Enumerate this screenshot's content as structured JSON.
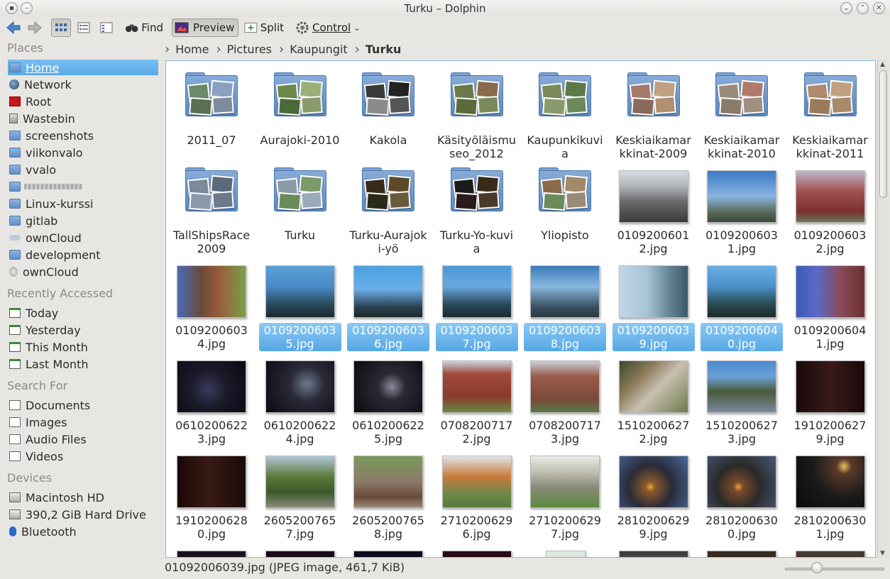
{
  "window": {
    "title": "Turku – Dolphin"
  },
  "toolbar": {
    "find": "Find",
    "preview": "Preview",
    "split": "Split",
    "control": "Control"
  },
  "places": {
    "sections": [
      {
        "title": "Places",
        "items": [
          {
            "label": "Home",
            "icon": "home-folder-icon",
            "selected": true
          },
          {
            "label": "Network",
            "icon": "network-globe-icon"
          },
          {
            "label": "Root",
            "icon": "root-folder-icon"
          },
          {
            "label": "Wastebin",
            "icon": "trash-icon"
          },
          {
            "label": "screenshots",
            "icon": "folder-icon"
          },
          {
            "label": "viikonvalo",
            "icon": "folder-icon"
          },
          {
            "label": "vvalo",
            "icon": "folder-icon"
          },
          {
            "label": "",
            "icon": "folder-icon",
            "blurred": true
          },
          {
            "label": "Linux-kurssi",
            "icon": "folder-icon"
          },
          {
            "label": "gitlab",
            "icon": "folder-icon"
          },
          {
            "label": "ownCloud",
            "icon": "cloud-icon"
          },
          {
            "label": "development",
            "icon": "globe-folder-icon"
          },
          {
            "label": "ownCloud",
            "icon": "network-drive-icon"
          }
        ]
      },
      {
        "title": "Recently Accessed",
        "items": [
          {
            "label": "Today",
            "icon": "calendar-today-icon"
          },
          {
            "label": "Yesterday",
            "icon": "calendar-yesterday-icon"
          },
          {
            "label": "This Month",
            "icon": "calendar-month-icon"
          },
          {
            "label": "Last Month",
            "icon": "calendar-last-month-icon"
          }
        ]
      },
      {
        "title": "Search For",
        "items": [
          {
            "label": "Documents",
            "icon": "document-icon"
          },
          {
            "label": "Images",
            "icon": "image-icon"
          },
          {
            "label": "Audio Files",
            "icon": "audio-icon"
          },
          {
            "label": "Videos",
            "icon": "video-icon"
          }
        ]
      },
      {
        "title": "Devices",
        "items": [
          {
            "label": "Macintosh HD",
            "icon": "harddrive-icon"
          },
          {
            "label": "390,2 GiB Hard Drive",
            "icon": "harddrive-icon"
          },
          {
            "label": "Bluetooth",
            "icon": "bluetooth-icon"
          }
        ]
      }
    ]
  },
  "breadcrumb": [
    "Home",
    "Pictures",
    "Kaupungit",
    "Turku"
  ],
  "files": [
    {
      "name": "2011_07",
      "type": "folder",
      "colors": [
        "#6a8a6a",
        "#8aa0c0",
        "#5a7050",
        "#7c8c9c"
      ]
    },
    {
      "name": "Aurajoki-2010",
      "type": "folder",
      "colors": [
        "#6a8a4a",
        "#9ab07a",
        "#4a6a3a",
        "#8a9a6a"
      ]
    },
    {
      "name": "Kakola",
      "type": "folder",
      "colors": [
        "#3a3a3a",
        "#222",
        "#8a8a8a",
        "#555"
      ]
    },
    {
      "name": "Käsityöläismuseo_2012",
      "type": "folder",
      "colors": [
        "#6a7a4a",
        "#8a6a4a",
        "#5a6a3a",
        "#7a8a5a"
      ]
    },
    {
      "name": "Kaupunkikuvia",
      "type": "folder",
      "colors": [
        "#7a8a5a",
        "#5a7a4a",
        "#8a9a6a",
        "#6a8a5a"
      ]
    },
    {
      "name": "Keskiaikamarkkinat-2009",
      "type": "folder",
      "colors": [
        "#a87a6a",
        "#c0a080",
        "#8a6a5a",
        "#b09070"
      ]
    },
    {
      "name": "Keskiaikamarkkinat-2010",
      "type": "folder",
      "colors": [
        "#9a8a7a",
        "#b07a6a",
        "#8a7a6a",
        "#a09080"
      ]
    },
    {
      "name": "Keskiaikamarkkinat-2011",
      "type": "folder",
      "colors": [
        "#b08a6a",
        "#c0a080",
        "#9a7a5a",
        "#a88a6a"
      ]
    },
    {
      "name": "TallShipsRace2009",
      "type": "folder",
      "colors": [
        "#7a8a9a",
        "#5a6a7a",
        "#8a9aaa",
        "#6a7a8a"
      ]
    },
    {
      "name": "Turku",
      "type": "folder",
      "colors": [
        "#8a9aaa",
        "#7a9a6a",
        "#6a8a5a",
        "#9aaabb"
      ]
    },
    {
      "name": "Turku-Aurajoki-yö",
      "type": "folder",
      "colors": [
        "#3a2a1a",
        "#5a4a2a",
        "#2a2a1a",
        "#6a5a3a"
      ]
    },
    {
      "name": "Turku-Yo-kuvia",
      "type": "folder",
      "colors": [
        "#1a1a1a",
        "#3a2a1a",
        "#2a1a1a",
        "#4a3a2a"
      ]
    },
    {
      "name": "Yliopisto",
      "type": "folder",
      "colors": [
        "#8a6a4a",
        "#a08a6a",
        "#6a8a5a",
        "#9a8a7a"
      ]
    },
    {
      "name": "01092006012.jpg",
      "type": "image",
      "bg": "linear-gradient(#d8dce4 0%,#b0b4b8 30%,#6a6a6a 60%,#3a3a3a 100%)"
    },
    {
      "name": "01092006031.jpg",
      "type": "image",
      "bg": "linear-gradient(#3a7ac8 0%,#8ab4e0 50%,#5a6a5a 80%,#3a4a3a 100%)"
    },
    {
      "name": "01092006032.jpg",
      "type": "image",
      "bg": "linear-gradient(#c0b8c8 0%,#a05050 40%,#7a3030 80%,#6a7a5a 100%)"
    },
    {
      "name": "01092006034.jpg",
      "type": "image",
      "bg": "linear-gradient(90deg,#4a6ab8 0%,#6a4a3a 35%,#9a5a3a 60%,#7aa04a 100%)"
    },
    {
      "name": "01092006035.jpg",
      "type": "image",
      "bg": "linear-gradient(#5aa0d8 0%,#4a8ac8 40%,#2a4a5a 75%,#1a2a30 100%)",
      "selected": true
    },
    {
      "name": "01092006036.jpg",
      "type": "image",
      "bg": "linear-gradient(#4aa0e0 0%,#6ab0e8 45%,#2a4050 80%,#1a2a2a 100%)",
      "selected": true
    },
    {
      "name": "01092006037.jpg",
      "type": "image",
      "bg": "linear-gradient(#4a98d8 0%,#6aa8e0 40%,#2a4a5a 75%,#1a2a30 100%)",
      "selected": true
    },
    {
      "name": "01092006038.jpg",
      "type": "image",
      "bg": "linear-gradient(#3a7ab8 0%,#8ab8e0 40%,#3a5060 80%,#2a3a40 100%)",
      "selected": true
    },
    {
      "name": "01092006039.jpg",
      "type": "image",
      "bg": "linear-gradient(90deg,#c0d8e8 0%,#a8c4d8 40%,#6a8a9a 70%,#3a5a6a 100%)",
      "selected": true
    },
    {
      "name": "01092006040.jpg",
      "type": "image",
      "bg": "linear-gradient(#6ab0e8 0%,#4a90c8 40%,#2a4a50 75%,#1a2a2a 100%)",
      "selected": true
    },
    {
      "name": "01092006041.jpg",
      "type": "image",
      "bg": "linear-gradient(90deg,#3a5ab8 0%,#5a6ac8 30%,#8a4a5a 65%,#6a3030 100%)"
    },
    {
      "name": "06102006223.jpg",
      "type": "image",
      "bg": "radial-gradient(circle at 45% 55%,#3a3a5a 0%,#1a1a2a 40%,#0a0a12 100%)"
    },
    {
      "name": "06102006224.jpg",
      "type": "image",
      "bg": "radial-gradient(circle at 60% 45%,#6a7a8a 0%,#2a2a38 35%,#0a0a12 100%)"
    },
    {
      "name": "06102006225.jpg",
      "type": "image",
      "bg": "radial-gradient(circle at 55% 50%,#8a8a9a 0%,#2a2a34 30%,#0a0a10 100%)"
    },
    {
      "name": "07082007172.jpg",
      "type": "image",
      "bg": "linear-gradient(#c8d4e0 0%,#a04a3a 25%,#8a3a2a 70%,#6a8a4a 100%)"
    },
    {
      "name": "07082007173.jpg",
      "type": "image",
      "bg": "linear-gradient(#c8d0d8 0%,#9a5a4a 30%,#7a4a3a 75%,#5a7a4a 100%)"
    },
    {
      "name": "15102006272.jpg",
      "type": "image",
      "bg": "linear-gradient(135deg,#3a4a2a 0%,#8a7a5a 30%,#c8c0b0 55%,#6a7a4a 100%)"
    },
    {
      "name": "15102006273.jpg",
      "type": "image",
      "bg": "linear-gradient(#4a8ad0 0%,#6aa0d8 30%,#4a5a3a 60%,#7a8aa0 100%)"
    },
    {
      "name": "19102006279.jpg",
      "type": "image",
      "bg": "linear-gradient(90deg,#1a0a0a 0%,#3a1a1a 50%,#1a0a0a 100%)"
    },
    {
      "name": "19102006280.jpg",
      "type": "image",
      "bg": "linear-gradient(90deg,#1a0808 0%,#3a1a14 45%,#1a0a0a 100%)"
    },
    {
      "name": "26052007657.jpg",
      "type": "image",
      "bg": "linear-gradient(#b0c8d8 0%,#5a7a3a 40%,#3a5a2a 70%,#8a8a7a 100%)"
    },
    {
      "name": "26052007658.jpg",
      "type": "image",
      "bg": "linear-gradient(#7a9a5a 0%,#8a7a6a 50%,#6a4a3a 80%,#9a8a7a 100%)"
    },
    {
      "name": "27102006296.jpg",
      "type": "image",
      "bg": "linear-gradient(#e0e4e8 0%,#c87a3a 40%,#6a8a4a 75%,#5a7a3a 100%)"
    },
    {
      "name": "27102006297.jpg",
      "type": "image",
      "bg": "linear-gradient(#e8ece8 0%,#b8b8a8 35%,#8a8a7a 60%,#5a8a3a 100%)"
    },
    {
      "name": "28102006299.jpg",
      "type": "image",
      "bg": "radial-gradient(circle at 45% 60%,#f0a040 0%,#8a5a2a 10%,#2a2a3a 45%,#4a6a9a 100%)"
    },
    {
      "name": "28102006300.jpg",
      "type": "image",
      "bg": "radial-gradient(circle at 45% 60%,#f0a040 0%,#7a4a2a 10%,#2a2a2a 45%,#4a5a7a 100%)"
    },
    {
      "name": "28102006301.jpg",
      "type": "image",
      "bg": "radial-gradient(circle at 70% 20%,#f0c060 0%,#5a3a2a 12%,#1a1a1a 50%,#0a0a0a 100%)"
    }
  ],
  "partial_row": [
    {
      "bg": "linear-gradient(#1a1020,#0a0a10)"
    },
    {
      "bg": "linear-gradient(#1a0a1a,#0a0a0a)"
    },
    {
      "bg": "linear-gradient(#100a20,#080810)"
    },
    {
      "bg": "linear-gradient(#2a0a1a,#0a0a0a)"
    },
    {
      "bg": "linear-gradient(#e0e8e0,#c8d0c8)",
      "narrow": true
    },
    {
      "bg": "linear-gradient(#3a3a3a,#8a8a8a)"
    },
    {
      "bg": "linear-gradient(#3a2a1a,#1a1a1a)"
    },
    {
      "bg": "linear-gradient(#4a3a2a,#2a2a2a)"
    }
  ],
  "status": {
    "text": "01092006039.jpg (JPEG image, 461,7 KiB)",
    "zoom_level": 0.3
  },
  "colors": {
    "selection": "#56a8e6",
    "view_border": "#8ab6e0"
  }
}
